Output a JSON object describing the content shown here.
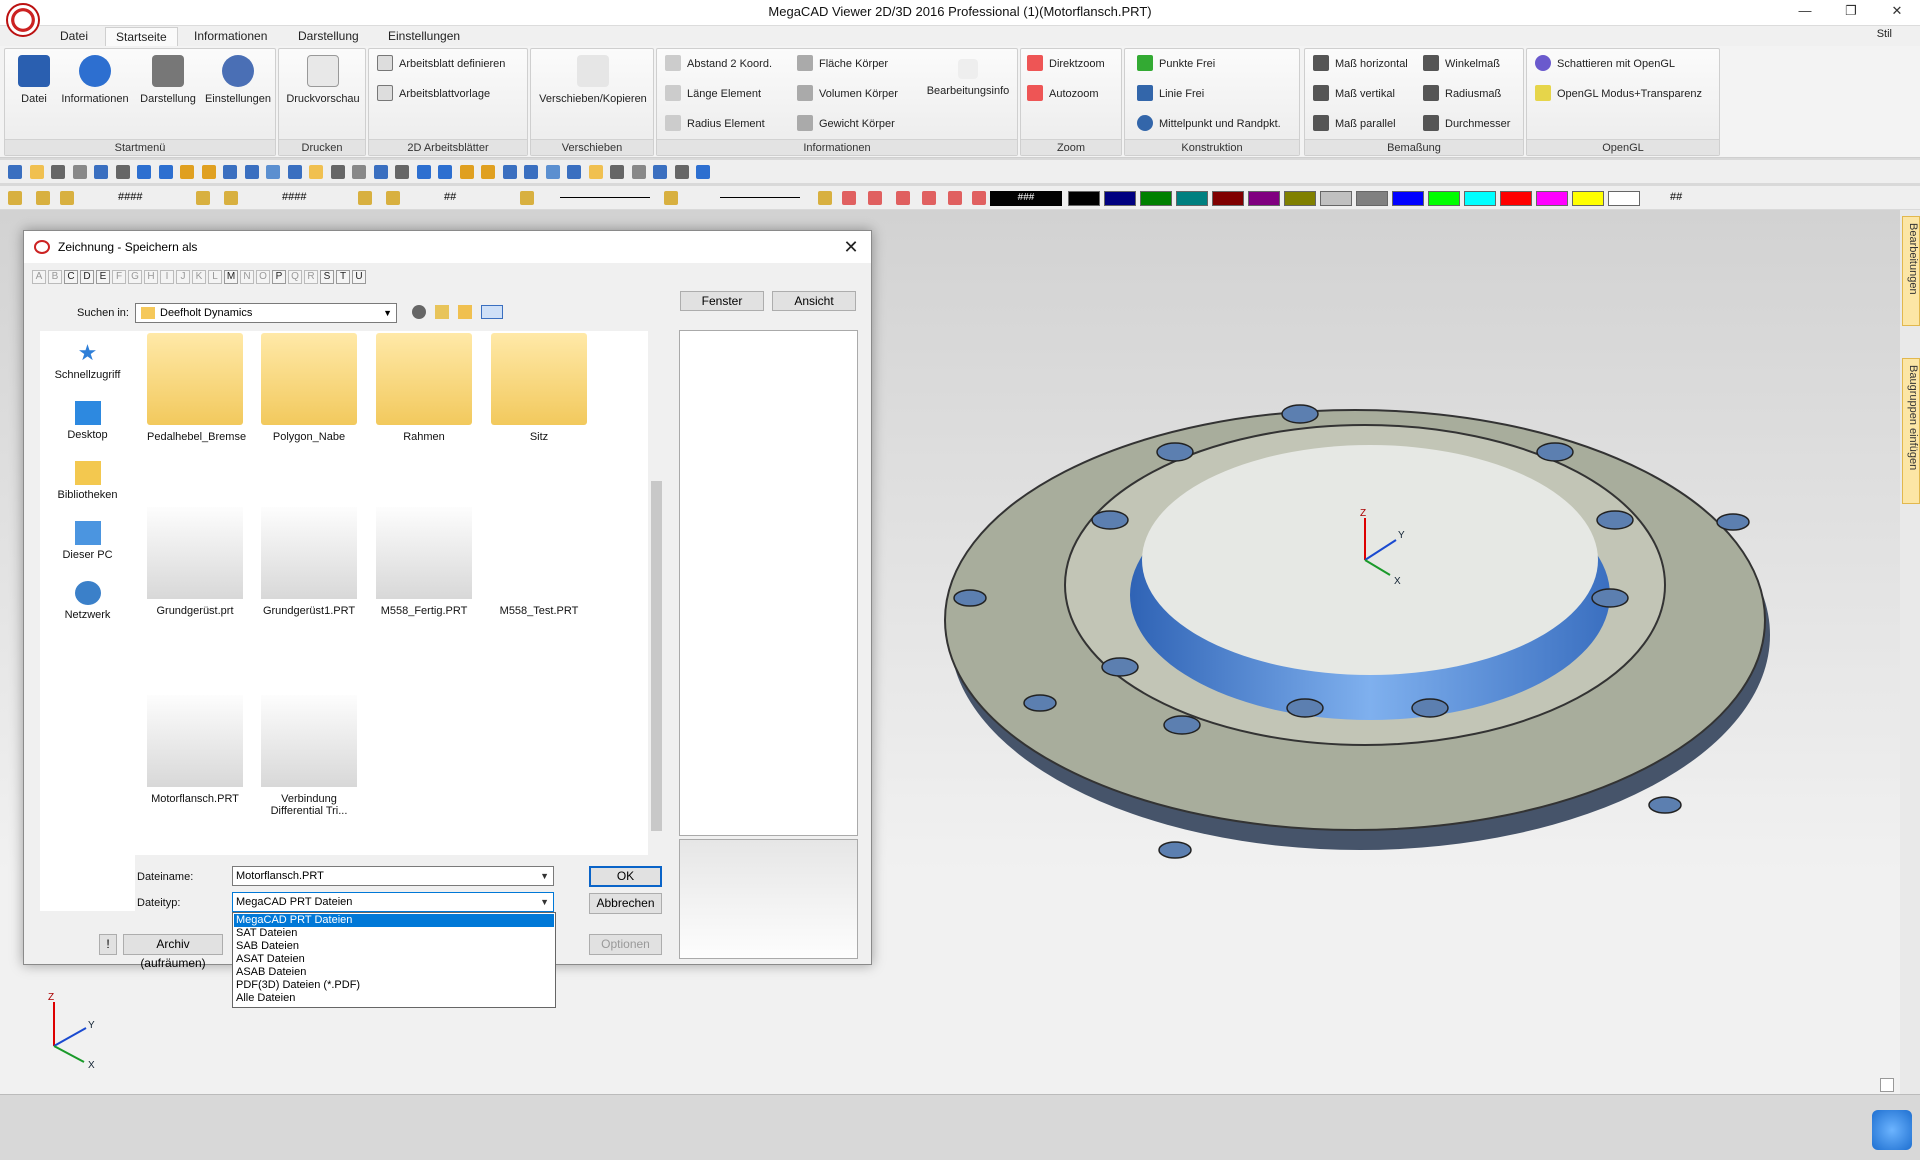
{
  "app": {
    "title": "MegaCAD Viewer 2D/3D 2016 Professional (1)(Motorflansch.PRT)",
    "stil": "Stil",
    "min": "—",
    "restore": "❐",
    "close": "✕"
  },
  "tabs": [
    "Datei",
    "Startseite",
    "Informationen",
    "Darstellung",
    "Einstellungen"
  ],
  "ribbon": {
    "startmenu": {
      "label": "Startmenü",
      "buttons": [
        "Datei",
        "Informationen",
        "Darstellung",
        "Einstellungen"
      ]
    },
    "drucken": {
      "label": "Drucken",
      "buttons": [
        "Druckvorschau"
      ]
    },
    "arbeitsblaetter": {
      "label": "2D Arbeitsblätter",
      "buttons": [
        "Arbeitsblatt definieren",
        "Arbeitsblattvorlage"
      ]
    },
    "verschieben": {
      "label": "Verschieben",
      "buttons": [
        "Verschieben/Kopieren"
      ]
    },
    "informationen": {
      "label": "Informationen",
      "col1": [
        "Abstand 2 Koord.",
        "Länge Element",
        "Radius Element"
      ],
      "col2": [
        "Fläche Körper",
        "Volumen Körper",
        "Gewicht Körper"
      ],
      "big": "Bearbeitungsinfo"
    },
    "zoom": {
      "label": "Zoom",
      "buttons": [
        "Direktzoom",
        "Autozoom"
      ]
    },
    "konstruktion": {
      "label": "Konstruktion",
      "buttons": [
        "Punkte Frei",
        "Linie Frei",
        "Mittelpunkt und Randpkt."
      ]
    },
    "bemassung": {
      "label": "Bemaßung",
      "col1": [
        "Maß horizontal",
        "Maß vertikal",
        "Maß parallel"
      ],
      "col2": [
        "Winkelmaß",
        "Radiusmaß",
        "Durchmesser"
      ]
    },
    "opengl": {
      "label": "OpenGL",
      "buttons": [
        "Schattieren mit OpenGL",
        "OpenGL Modus+Transparenz"
      ]
    }
  },
  "toolbar3": {
    "hash1": "####",
    "hash2": "####",
    "hash3": "##",
    "colorhash": "###",
    "endhash": "##"
  },
  "colors": [
    "#000000",
    "#000080",
    "#008000",
    "#008080",
    "#800000",
    "#800080",
    "#808000",
    "#c0c0c0",
    "#808080",
    "#0000ff",
    "#00ff00",
    "#00ffff",
    "#ff0000",
    "#ff00ff",
    "#ffff00",
    "#ffffff"
  ],
  "sidetabs": [
    "Bearbeitungen",
    "Baugruppen einfügen"
  ],
  "dialog": {
    "title": "Zeichnung - Speichern als",
    "letters": [
      "A",
      "B",
      "C",
      "D",
      "E",
      "F",
      "G",
      "H",
      "I",
      "J",
      "K",
      "L",
      "M",
      "N",
      "O",
      "P",
      "Q",
      "R",
      "S",
      "T",
      "U"
    ],
    "active_letters": [
      "C",
      "D",
      "E",
      "M",
      "P",
      "S",
      "T",
      "U"
    ],
    "lookin_label": "Suchen in:",
    "lookin_value": "Deefholt Dynamics",
    "fenster": "Fenster",
    "ansicht": "Ansicht",
    "places": [
      "Schnellzugriff",
      "Desktop",
      "Bibliotheken",
      "Dieser PC",
      "Netzwerk"
    ],
    "folders": [
      "Pedalhebel_Bremse",
      "Polygon_Nabe",
      "Rahmen",
      "Sitz"
    ],
    "files": [
      "Grundgerüst.prt",
      "Grundgerüst1.PRT",
      "M558_Fertig.PRT",
      "M558_Test.PRT",
      "Motorflansch.PRT",
      "Verbindung Differential Tri..."
    ],
    "filename_label": "Dateiname:",
    "filename_value": "Motorflansch.PRT",
    "filetype_label": "Dateityp:",
    "filetype_value": "MegaCAD PRT Dateien",
    "ok": "OK",
    "cancel": "Abbrechen",
    "options": "Optionen",
    "excl": "!",
    "archive": "Archiv (aufräumen)",
    "filetype_options": [
      "MegaCAD PRT Dateien",
      "SAT Dateien",
      "SAB Dateien",
      "ASAT Dateien",
      "ASAB Dateien",
      "PDF(3D) Dateien (*.PDF)",
      "Alle Dateien"
    ]
  },
  "axes": {
    "x": "X",
    "y": "Y",
    "z": "Z"
  }
}
